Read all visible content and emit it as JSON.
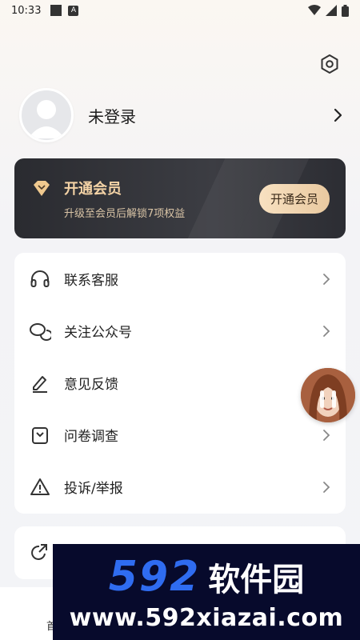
{
  "status_bar": {
    "time": "10:33",
    "badge": "A"
  },
  "profile": {
    "login_text": "未登录"
  },
  "vip": {
    "title": "开通会员",
    "subtitle": "升级至会员后解锁7项权益",
    "button_label": "开通会员",
    "accent": "#f4d3a6"
  },
  "menu": {
    "items": [
      {
        "label": "联系客服",
        "icon": "headset-icon"
      },
      {
        "label": "关注公众号",
        "icon": "chat-bubbles-icon"
      },
      {
        "label": "意见反馈",
        "icon": "pencil-icon"
      },
      {
        "label": "问卷调查",
        "icon": "clipboard-icon"
      },
      {
        "label": "投诉/举报",
        "icon": "warning-icon"
      }
    ]
  },
  "menu2": {
    "icon": "share-icon"
  },
  "bottom_nav": {
    "label": "首"
  },
  "watermark": {
    "brand_num": "592",
    "brand_cn": "软件园",
    "url": "www.592xiazai.com"
  }
}
